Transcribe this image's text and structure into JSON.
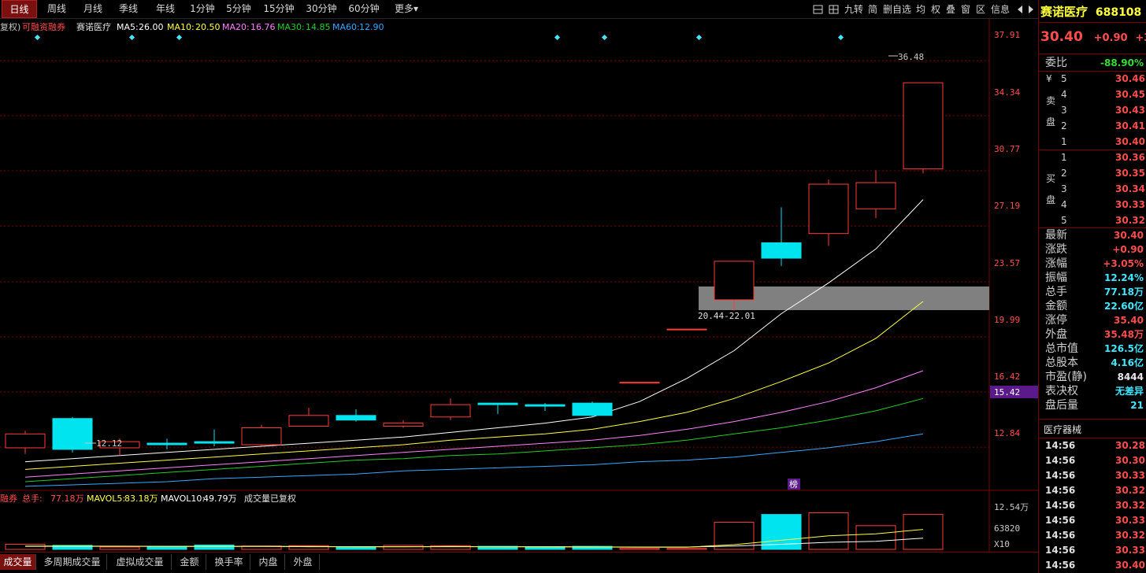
{
  "toolbar": {
    "period_tabs": [
      "日线",
      "周线",
      "月线",
      "季线",
      "年线",
      "1分钟",
      "5分钟",
      "15分钟",
      "30分钟",
      "60分钟",
      "更多"
    ],
    "active_tab": "日线",
    "more_arrow": "▾",
    "tools": [
      "九转",
      "简",
      "删自选",
      "均",
      "权",
      "叠",
      "窗",
      "区",
      "信息"
    ],
    "tool_icons": [
      "ruler-icon",
      "grid-icon"
    ]
  },
  "stock": {
    "name": "赛诺医疗",
    "code": "688108",
    "price": "30.40",
    "change": "+0.90",
    "change_pct_partial": "+3"
  },
  "main_legend": {
    "prefix": "复权)",
    "margin": "可融资融券",
    "name": "赛诺医疗",
    "ma5_label": "MA5:",
    "ma5": "26.00",
    "ma10_label": "MA10:",
    "ma10": "20.50",
    "ma20_label": "MA20:",
    "ma20": "16.76",
    "ma30_label": "MA30:",
    "ma30": "14.85",
    "ma60_label": "MA60:",
    "ma60": "12.90"
  },
  "vol_legend": {
    "prefix": "融券",
    "total_label": "总手:",
    "total": "77.18万",
    "mavol5_label": "MAVOL5:",
    "mavol5": "83.18万",
    "mavol10_label": "MAVOL10:",
    "mavol10": "49.79万",
    "note": "成交量已复权"
  },
  "axis": {
    "price_ticks": [
      "37.91",
      "34.34",
      "30.77",
      "27.19",
      "23.57",
      "19.99",
      "16.42",
      "12.84"
    ],
    "current_tag": "15.42",
    "vol_ticks": [
      "12.54万",
      "63820",
      "X10"
    ]
  },
  "annotations": {
    "high": "36.48",
    "low": "12.12",
    "gap": "20.44-22.01",
    "bang": "榜"
  },
  "colors": {
    "up": "#ff3c3c",
    "down": "#00e4f0",
    "ma5": "#ffffff",
    "ma10": "#ffff3c",
    "ma20": "#ff80ff",
    "ma30": "#22cc22",
    "ma60": "#33aaff",
    "grid": "#7a0000"
  },
  "chart_data": {
    "type": "candlestick",
    "ylim": [
      10.5,
      39.6
    ],
    "candles": [
      {
        "o": 12.8,
        "c": 13.7,
        "h": 13.9,
        "l": 12.4
      },
      {
        "o": 14.7,
        "c": 12.7,
        "h": 14.8,
        "l": 12.5
      },
      {
        "o": 12.8,
        "c": 13.2,
        "h": 13.4,
        "l": 12.3
      },
      {
        "o": 13.1,
        "c": 13.0,
        "h": 13.4,
        "l": 12.7
      },
      {
        "o": 13.2,
        "c": 13.1,
        "h": 14.0,
        "l": 12.9
      },
      {
        "o": 13.0,
        "c": 14.1,
        "h": 14.3,
        "l": 12.9
      },
      {
        "o": 14.2,
        "c": 14.9,
        "h": 15.4,
        "l": 14.2
      },
      {
        "o": 14.9,
        "c": 14.6,
        "h": 15.3,
        "l": 14.5
      },
      {
        "o": 14.2,
        "c": 14.4,
        "h": 14.6,
        "l": 14.1
      },
      {
        "o": 14.8,
        "c": 15.6,
        "h": 16.0,
        "l": 14.6
      },
      {
        "o": 15.7,
        "c": 15.6,
        "h": 15.7,
        "l": 15.0
      },
      {
        "o": 15.6,
        "c": 15.5,
        "h": 15.7,
        "l": 15.2
      },
      {
        "o": 15.7,
        "c": 14.9,
        "h": 15.8,
        "l": 14.8
      },
      {
        "o": 17.05,
        "c": 17.05,
        "h": 17.05,
        "l": 17.05
      },
      {
        "o": 20.5,
        "c": 20.5,
        "h": 20.5,
        "l": 20.5
      },
      {
        "o": 22.4,
        "c": 24.9,
        "h": 24.9,
        "l": 21.7
      },
      {
        "o": 26.1,
        "c": 25.1,
        "h": 28.4,
        "l": 24.6
      },
      {
        "o": 26.7,
        "c": 29.9,
        "h": 30.2,
        "l": 25.9
      },
      {
        "o": 28.3,
        "c": 30.0,
        "h": 30.8,
        "l": 27.7
      },
      {
        "o": 30.9,
        "c": 36.48,
        "h": 36.48,
        "l": 30.6
      }
    ],
    "ma5": [
      11.9,
      12.1,
      12.3,
      12.5,
      12.7,
      12.9,
      13.1,
      13.3,
      13.5,
      13.8,
      14.1,
      14.4,
      14.8,
      15.8,
      17.3,
      19.1,
      21.5,
      23.5,
      25.7,
      28.9
    ],
    "ma10": [
      11.4,
      11.6,
      11.8,
      12.0,
      12.2,
      12.4,
      12.6,
      12.8,
      13.0,
      13.3,
      13.5,
      13.7,
      14.0,
      14.5,
      15.1,
      16.0,
      17.1,
      18.3,
      19.9,
      22.3
    ],
    "ma20": [
      10.9,
      11.1,
      11.3,
      11.5,
      11.7,
      11.9,
      12.1,
      12.3,
      12.5,
      12.7,
      12.9,
      13.1,
      13.3,
      13.6,
      14.0,
      14.5,
      15.1,
      15.8,
      16.7,
      17.8
    ],
    "ma30": [
      10.6,
      10.8,
      11.0,
      11.2,
      11.4,
      11.6,
      11.8,
      12.0,
      12.1,
      12.3,
      12.4,
      12.6,
      12.8,
      13.0,
      13.3,
      13.7,
      14.1,
      14.6,
      15.2,
      16.0
    ],
    "ma60": [
      10.3,
      10.4,
      10.5,
      10.6,
      10.8,
      10.9,
      11.0,
      11.1,
      11.3,
      11.4,
      11.5,
      11.6,
      11.7,
      11.9,
      12.0,
      12.2,
      12.5,
      12.8,
      13.2,
      13.7
    ],
    "volume_ylim": [
      0,
      125400
    ],
    "volume": [
      15000,
      12000,
      7000,
      9000,
      13000,
      10000,
      11000,
      8000,
      12000,
      11000,
      9000,
      8000,
      9000,
      3000,
      3000,
      80000,
      103000,
      108000,
      70000,
      103000
    ],
    "vol_ma5": [
      10000,
      10000,
      9500,
      9000,
      9000,
      9000,
      8500,
      8000,
      8000,
      8500,
      8000,
      7500,
      7000,
      6500,
      6500,
      14000,
      27000,
      40000,
      46000,
      59000
    ],
    "vol_ma10": [
      9000,
      9000,
      9000,
      8500,
      8500,
      8500,
      8000,
      8000,
      8000,
      8000,
      8000,
      8000,
      7500,
      7000,
      7000,
      10000,
      15000,
      21000,
      24000,
      33000
    ]
  },
  "orderbook": {
    "weibi_label": "委比",
    "weibi": "-88.90%",
    "sell_side": [
      "¥",
      "卖",
      "盘"
    ],
    "buy_side": [
      "买",
      "盘"
    ],
    "sells": [
      {
        "level": "5",
        "price": "30.46"
      },
      {
        "level": "4",
        "price": "30.45"
      },
      {
        "level": "3",
        "price": "30.43"
      },
      {
        "level": "2",
        "price": "30.41"
      },
      {
        "level": "1",
        "price": "30.40"
      }
    ],
    "buys": [
      {
        "level": "1",
        "price": "30.36"
      },
      {
        "level": "2",
        "price": "30.35"
      },
      {
        "level": "3",
        "price": "30.34"
      },
      {
        "level": "4",
        "price": "30.33"
      },
      {
        "level": "5",
        "price": "30.32"
      }
    ]
  },
  "stats": [
    {
      "label": "最新",
      "value": "30.40",
      "color": "#ff4d4d"
    },
    {
      "label": "涨跌",
      "value": "+0.90",
      "color": "#ff4d4d"
    },
    {
      "label": "涨幅",
      "value": "+3.05%",
      "color": "#ff4d4d"
    },
    {
      "label": "振幅",
      "value": "12.24%",
      "color": "#3ee8ff"
    },
    {
      "label": "总手",
      "value": "77.18万",
      "color": "#3ee8ff"
    },
    {
      "label": "金额",
      "value": "22.60亿",
      "color": "#3ee8ff"
    },
    {
      "label": "涨停",
      "value": "35.40",
      "color": "#ff4d4d"
    },
    {
      "label": "外盘",
      "value": "35.48万",
      "color": "#ff4d4d"
    },
    {
      "label": "总市值",
      "value": "126.5亿",
      "color": "#3ee8ff"
    },
    {
      "label": "总股本",
      "value": "4.16亿",
      "color": "#3ee8ff"
    },
    {
      "label": "市盈(静)",
      "value": "8444",
      "color": "#e8e8e8"
    },
    {
      "label": "表决权",
      "value": "无差异",
      "color": "#3ee8ff"
    },
    {
      "label": "盘后量",
      "value": "21",
      "color": "#3ee8ff"
    }
  ],
  "sector": "医疗器械",
  "ticks": [
    {
      "time": "14:56",
      "price": "30.28"
    },
    {
      "time": "14:56",
      "price": "30.30"
    },
    {
      "time": "14:56",
      "price": "30.33"
    },
    {
      "time": "14:56",
      "price": "30.32"
    },
    {
      "time": "14:56",
      "price": "30.32"
    },
    {
      "time": "14:56",
      "price": "30.33"
    },
    {
      "time": "14:56",
      "price": "30.32"
    },
    {
      "time": "14:56",
      "price": "30.33"
    },
    {
      "time": "14:56",
      "price": "30.40"
    }
  ],
  "bottom_tabs": [
    "成交量",
    "多周期成交量",
    "虚拟成交量",
    "金额",
    "换手率",
    "内盘",
    "外盘"
  ],
  "bottom_active": "成交量"
}
